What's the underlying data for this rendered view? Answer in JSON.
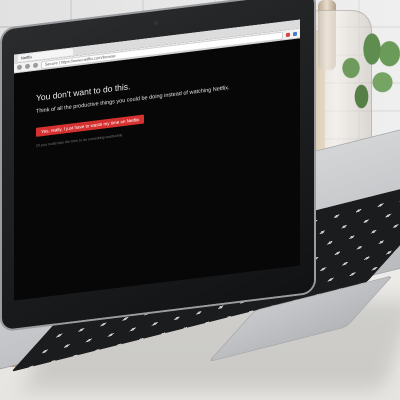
{
  "browser": {
    "tab_title": "Netflix",
    "address": "Secure | https://www.netflix.com/browse"
  },
  "extension_page": {
    "heading": "You don't want to do this.",
    "subtext": "Think of all the productive things you could be doing instead of watching Netflix.",
    "button_label": "Yes, really. I just have to waste my time on Netflix",
    "footnote": "Or you could take the time to do something worthwhile"
  },
  "colors": {
    "button_red": "#d63131",
    "page_bg": "#070707"
  },
  "icons": [
    "back-icon",
    "forward-icon",
    "reload-icon",
    "extension-icon"
  ]
}
